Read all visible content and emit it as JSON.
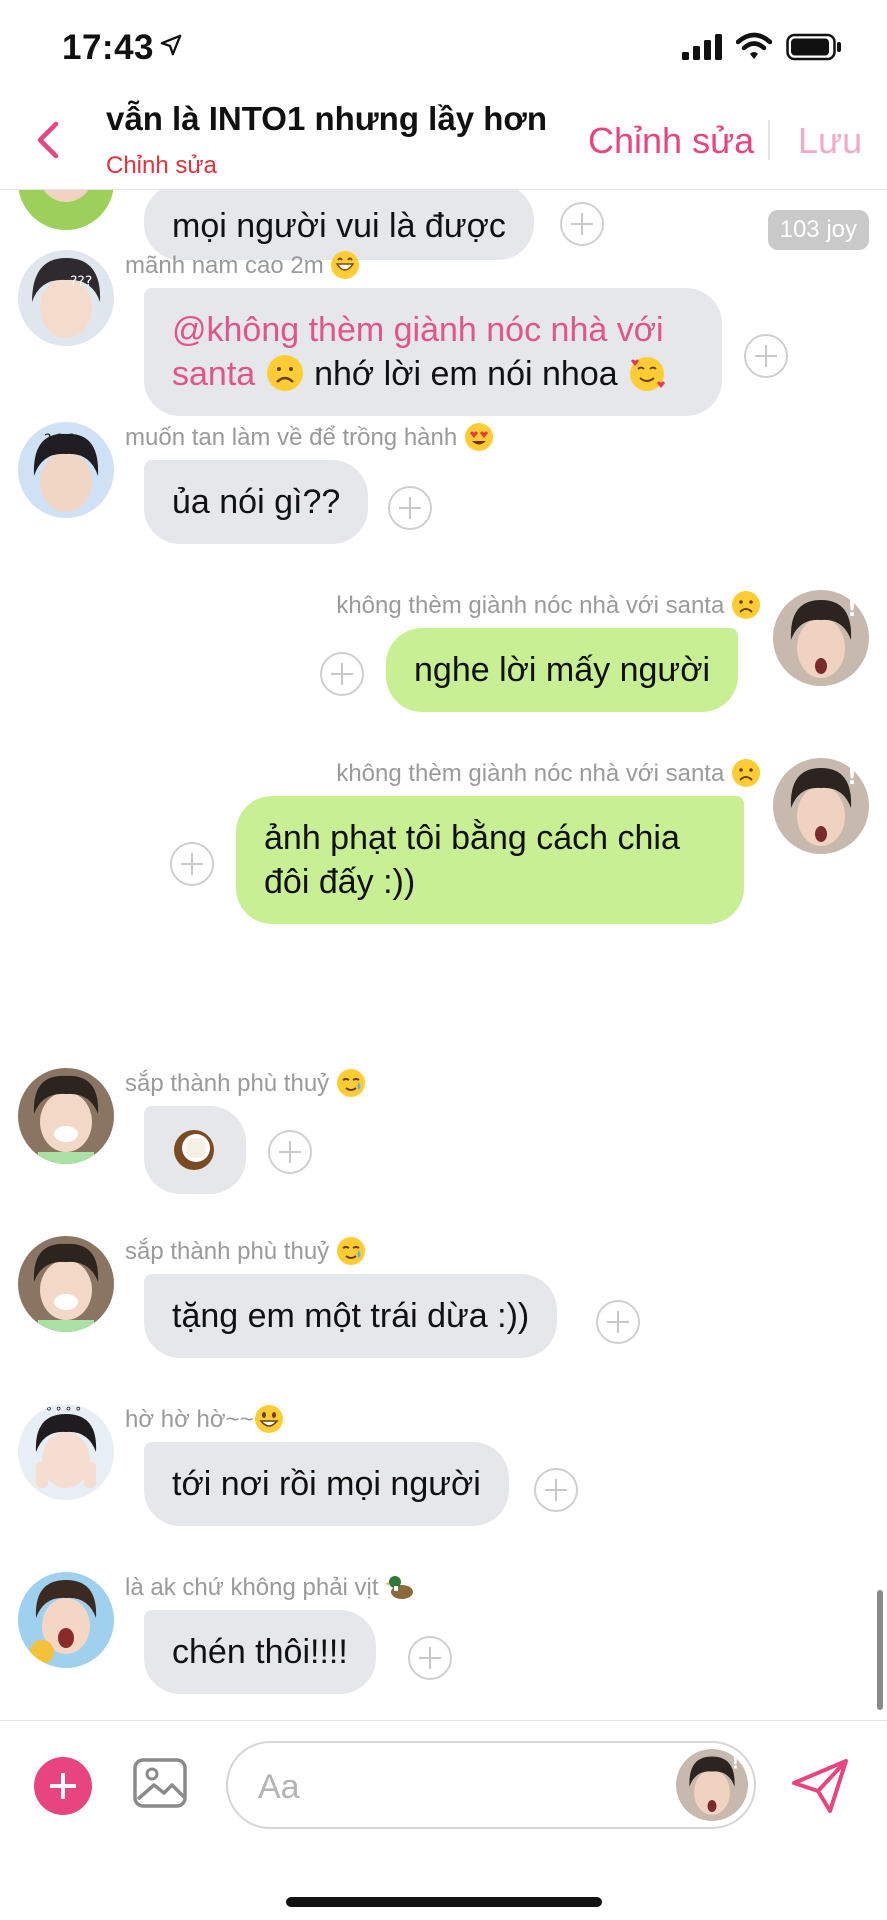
{
  "status_bar": {
    "time": "17:43",
    "location_icon": "location-arrow-icon",
    "signal_icon": "cellular-signal-icon",
    "wifi_icon": "wifi-icon",
    "battery_icon": "battery-icon"
  },
  "header": {
    "title": "vẫn là INTO1 nhưng lầy hơn",
    "subtitle": "Chỉnh sửa",
    "edit_label": "Chỉnh sửa",
    "save_label": "Lưu",
    "accent_color": "#e8447f"
  },
  "messages": [
    {
      "direction": "in",
      "sender": "",
      "text": "mọi người vui là được",
      "badge": "103 joy"
    },
    {
      "direction": "in",
      "sender": "mãnh nam cao 2m",
      "mention": "@không thèm giành nóc nhà với santa",
      "text": "nhớ lời em nói nhoa"
    },
    {
      "direction": "in",
      "sender": "muốn tan làm về để trồng hành",
      "text": "ủa nói gì??"
    },
    {
      "direction": "out",
      "sender": "không thèm giành nóc nhà với santa",
      "text": "nghe lời mấy người"
    },
    {
      "direction": "out",
      "sender": "không thèm giành nóc nhà với santa",
      "text": "ảnh phạt tôi bằng cách chia đôi đấy :))"
    },
    {
      "direction": "in",
      "sender": "sắp thành phù thuỷ",
      "text": ""
    },
    {
      "direction": "in",
      "sender": "sắp thành phù thuỷ",
      "text": "tặng em một trái dừa :))"
    },
    {
      "direction": "in",
      "sender": "hờ hờ hờ~~",
      "text": "tới nơi rồi mọi người"
    },
    {
      "direction": "in",
      "sender": "là ak chứ không phải vịt",
      "text": "chén thôi!!!!"
    }
  ],
  "composer": {
    "placeholder": "Aa",
    "add_icon": "plus-icon",
    "image_icon": "image-icon",
    "send_icon": "send-icon"
  },
  "colors": {
    "incoming_bubble": "#e6e7eb",
    "outgoing_bubble": "#c8ef93",
    "mention": "#e0558c"
  }
}
